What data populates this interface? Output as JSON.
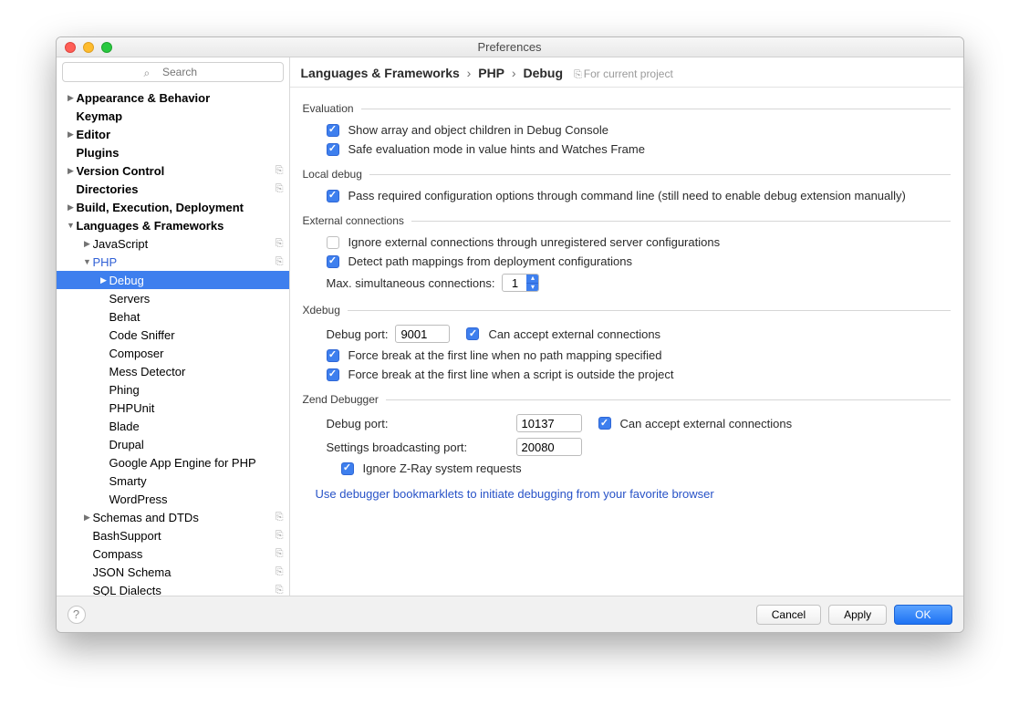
{
  "window": {
    "title": "Preferences"
  },
  "search": {
    "placeholder": "Search"
  },
  "tree": {
    "items": [
      {
        "label": "Appearance & Behavior",
        "indent": 0,
        "caret": "right",
        "bold": true
      },
      {
        "label": "Keymap",
        "indent": 0,
        "caret": "",
        "bold": true
      },
      {
        "label": "Editor",
        "indent": 0,
        "caret": "right",
        "bold": true
      },
      {
        "label": "Plugins",
        "indent": 0,
        "caret": "",
        "bold": true
      },
      {
        "label": "Version Control",
        "indent": 0,
        "caret": "right",
        "bold": true,
        "badge": true
      },
      {
        "label": "Directories",
        "indent": 0,
        "caret": "",
        "bold": true,
        "badge": true
      },
      {
        "label": "Build, Execution, Deployment",
        "indent": 0,
        "caret": "right",
        "bold": true
      },
      {
        "label": "Languages & Frameworks",
        "indent": 0,
        "caret": "down",
        "bold": true
      },
      {
        "label": "JavaScript",
        "indent": 1,
        "caret": "right",
        "badge": true
      },
      {
        "label": "PHP",
        "indent": 1,
        "caret": "down",
        "blue": true,
        "badge": true
      },
      {
        "label": "Debug",
        "indent": 2,
        "caret": "right",
        "sel": true
      },
      {
        "label": "Servers",
        "indent": 2
      },
      {
        "label": "Behat",
        "indent": 2
      },
      {
        "label": "Code Sniffer",
        "indent": 2
      },
      {
        "label": "Composer",
        "indent": 2
      },
      {
        "label": "Mess Detector",
        "indent": 2
      },
      {
        "label": "Phing",
        "indent": 2
      },
      {
        "label": "PHPUnit",
        "indent": 2
      },
      {
        "label": "Blade",
        "indent": 2
      },
      {
        "label": "Drupal",
        "indent": 2
      },
      {
        "label": "Google App Engine for PHP",
        "indent": 2
      },
      {
        "label": "Smarty",
        "indent": 2
      },
      {
        "label": "WordPress",
        "indent": 2
      },
      {
        "label": "Schemas and DTDs",
        "indent": 1,
        "caret": "right",
        "badge": true
      },
      {
        "label": "BashSupport",
        "indent": 1,
        "badge": true
      },
      {
        "label": "Compass",
        "indent": 1,
        "badge": true
      },
      {
        "label": "JSON Schema",
        "indent": 1,
        "badge": true
      },
      {
        "label": "SQL Dialects",
        "indent": 1,
        "badge": true
      }
    ]
  },
  "crumb": {
    "a": "Languages & Frameworks",
    "b": "PHP",
    "c": "Debug",
    "scope": "For current project"
  },
  "sections": {
    "evaluation": {
      "title": "Evaluation",
      "c1": "Show array and object children in Debug Console",
      "c2": "Safe evaluation mode in value hints and Watches Frame"
    },
    "local": {
      "title": "Local debug",
      "c1": "Pass required configuration options through command line (still need to enable debug extension manually)"
    },
    "ext": {
      "title": "External connections",
      "c1": "Ignore external connections through unregistered server configurations",
      "c2": "Detect path mappings from deployment configurations",
      "maxLabel": "Max. simultaneous connections:",
      "maxVal": "1"
    },
    "xdebug": {
      "title": "Xdebug",
      "portLabel": "Debug port:",
      "portVal": "9001",
      "c1": "Can accept external connections",
      "c2": "Force break at the first line when no path mapping specified",
      "c3": "Force break at the first line when a script is outside the project"
    },
    "zend": {
      "title": "Zend Debugger",
      "portLabel": "Debug port:",
      "portVal": "10137",
      "c1": "Can accept external connections",
      "bcastLabel": "Settings broadcasting port:",
      "bcastVal": "20080",
      "c2": "Ignore Z-Ray system requests"
    }
  },
  "link": "Use debugger bookmarklets to initiate debugging from your favorite browser",
  "buttons": {
    "cancel": "Cancel",
    "apply": "Apply",
    "ok": "OK"
  }
}
